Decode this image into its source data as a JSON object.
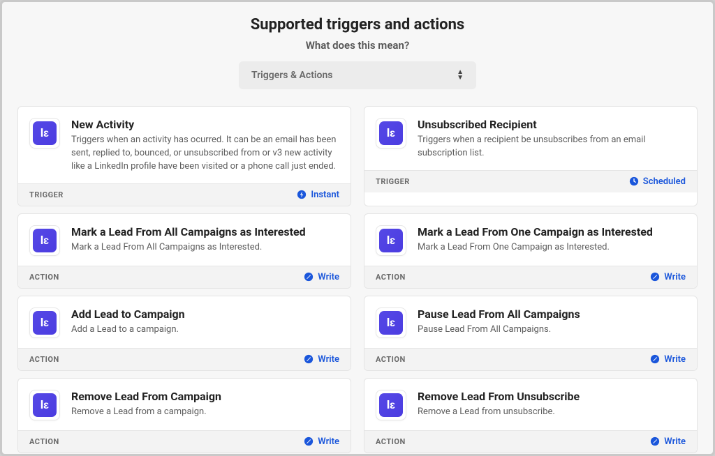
{
  "header": {
    "title": "Supported triggers and actions",
    "subtitle": "What does this mean?"
  },
  "filter": {
    "label": "Triggers & Actions"
  },
  "typeLabels": {
    "trigger": "TRIGGER",
    "action": "ACTION"
  },
  "badgeLabels": {
    "instant": "Instant",
    "scheduled": "Scheduled",
    "write": "Write"
  },
  "appLogoText": "lɛ",
  "cards": [
    {
      "title": "New Activity",
      "description": "Triggers when an activity has ocurred. It can be an email has been sent, replied to, bounced, or unsubscribed from or v3 new activity like a LinkedIn profile have been visited or a phone call just ended.",
      "type": "trigger",
      "badge": "instant"
    },
    {
      "title": "Unsubscribed Recipient",
      "description": "Triggers when a recipient be unsubscribes from an email subscription list.",
      "type": "trigger",
      "badge": "scheduled"
    },
    {
      "title": "Mark a Lead From All Campaigns as Interested",
      "description": "Mark a Lead From All Campaigns as Interested.",
      "type": "action",
      "badge": "write"
    },
    {
      "title": "Mark a Lead From One Campaign as Interested",
      "description": "Mark a Lead From One Campaign as Interested.",
      "type": "action",
      "badge": "write"
    },
    {
      "title": "Add Lead to Campaign",
      "description": "Add a Lead to a campaign.",
      "type": "action",
      "badge": "write"
    },
    {
      "title": "Pause Lead From All Campaigns",
      "description": "Pause Lead From All Campaigns.",
      "type": "action",
      "badge": "write"
    },
    {
      "title": "Remove Lead From Campaign",
      "description": "Remove a Lead from a campaign.",
      "type": "action",
      "badge": "write"
    },
    {
      "title": "Remove Lead From Unsubscribe",
      "description": "Remove a Lead from unsubscribe.",
      "type": "action",
      "badge": "write"
    }
  ]
}
